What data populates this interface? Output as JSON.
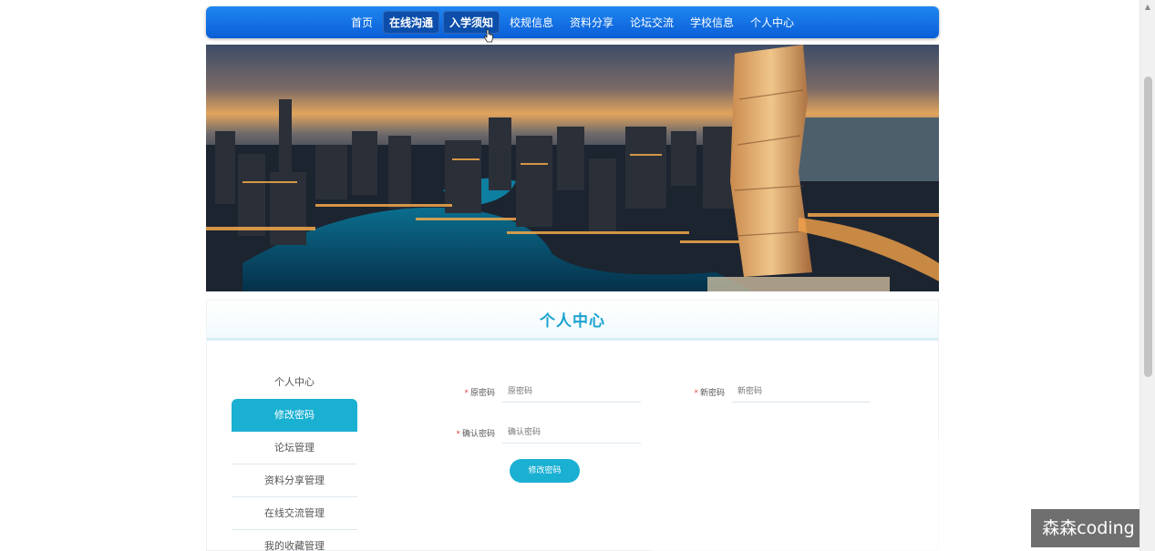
{
  "nav": {
    "items": [
      "首页",
      "在线沟通",
      "入学须知",
      "校规信息",
      "资料分享",
      "论坛交流",
      "学校信息",
      "个人中心"
    ]
  },
  "panel": {
    "title": "个人中心"
  },
  "sidebar": {
    "items": [
      "个人中心",
      "修改密码",
      "论坛管理",
      "资料分享管理",
      "在线交流管理",
      "我的收藏管理"
    ]
  },
  "form": {
    "required_mark": "*",
    "old_password": {
      "label": "原密码",
      "placeholder": "原密码"
    },
    "new_password": {
      "label": "新密码",
      "placeholder": "新密码"
    },
    "confirm_password": {
      "label": "确认密码",
      "placeholder": "确认密码"
    },
    "submit_label": "修改密码"
  },
  "watermark": "森森coding",
  "colors": {
    "nav": "#0a6fe3",
    "accent": "#1ab0d2",
    "title": "#1aa3cf",
    "required": "#e34b4b"
  }
}
